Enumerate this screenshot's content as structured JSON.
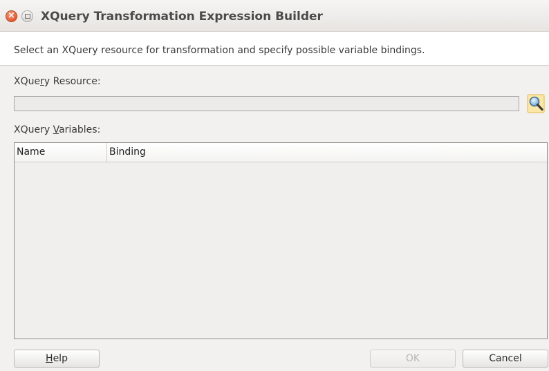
{
  "window": {
    "title": "XQuery Transformation Expression Builder"
  },
  "description": "Select an XQuery resource for transformation and specify possible variable bindings.",
  "resource": {
    "label_pre": "XQue",
    "label_mnemonic": "r",
    "label_post": "y Resource:",
    "value": "",
    "search_icon": "search-icon"
  },
  "variables": {
    "label_pre": "XQuery ",
    "label_mnemonic": "V",
    "label_post": "ariables:",
    "columns": [
      "Name",
      "Binding"
    ],
    "rows": []
  },
  "buttons": {
    "help_mnemonic": "H",
    "help_rest": "elp",
    "ok": "OK",
    "cancel": "Cancel"
  }
}
